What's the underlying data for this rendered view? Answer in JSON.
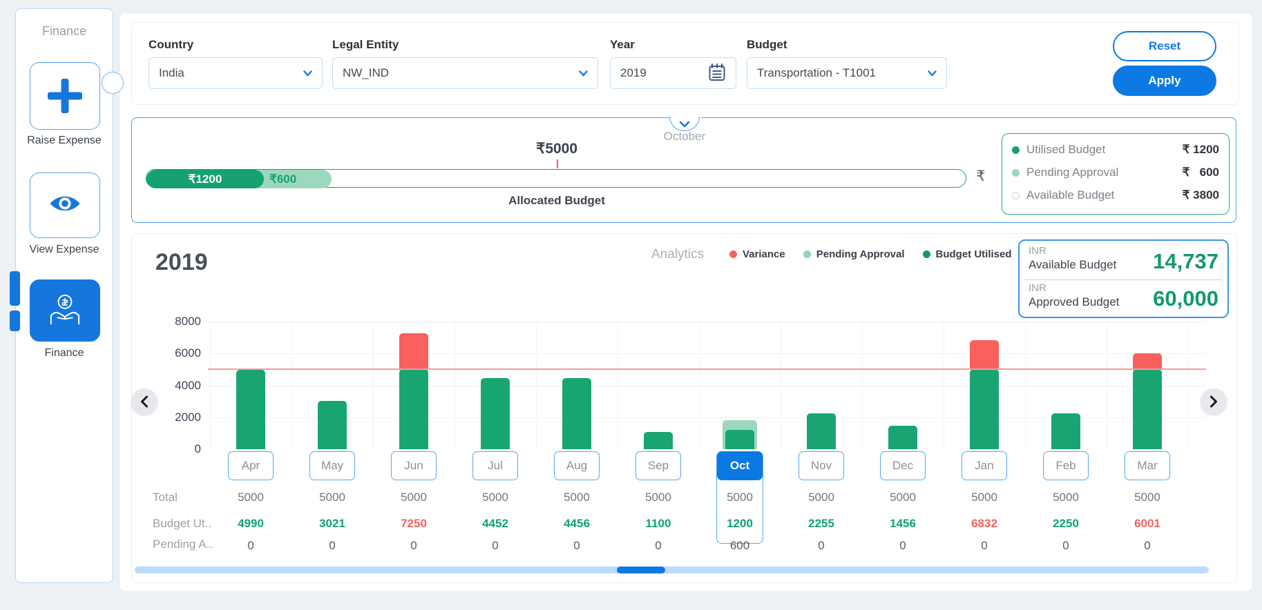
{
  "sidebar": {
    "title": "Finance",
    "items": [
      {
        "label": "Raise Expense",
        "icon": "plus-icon",
        "active": false
      },
      {
        "label": "View Expense",
        "icon": "eye-icon",
        "active": false
      },
      {
        "label": "Finance",
        "icon": "hands-coin-icon",
        "active": true
      }
    ]
  },
  "filters": {
    "fields": [
      {
        "label": "Country",
        "value": "India",
        "control": "select"
      },
      {
        "label": "Legal Entity",
        "value": "NW_IND",
        "control": "select"
      },
      {
        "label": "Year",
        "value": "2019",
        "control": "date",
        "icon": "calendar-icon"
      },
      {
        "label": "Budget",
        "value": "Transportation - T1001",
        "control": "select"
      }
    ],
    "reset_label": "Reset",
    "apply_label": "Apply"
  },
  "budget_bar": {
    "month": "October",
    "marker_label": "₹5000",
    "segments": [
      {
        "name": "utilised",
        "label": "₹1200"
      },
      {
        "name": "pending",
        "label": "₹600"
      }
    ],
    "bar_suffix": "₹",
    "axis_label": "Allocated Budget",
    "legend": [
      {
        "label": "Utilised Budget",
        "value": "₹ 1200",
        "color": "#16a173"
      },
      {
        "label": "Pending Approval",
        "value": "₹   600",
        "color": "#9bd8bd"
      },
      {
        "label": "Available Budget",
        "value": "₹ 3800",
        "color": "#ffffff"
      }
    ]
  },
  "analytics": {
    "section_label": "Analytics",
    "legend": [
      {
        "label": "Variance",
        "color": "#f5615c"
      },
      {
        "label": "Pending Approval",
        "color": "#8fd4b4"
      },
      {
        "label": "Budget Utilised",
        "color": "#12996b"
      }
    ],
    "summary": [
      {
        "currency": "INR",
        "label": "Available Budget",
        "value": "14,737"
      },
      {
        "currency": "INR",
        "label": "Approved Budget",
        "value": "60,000"
      }
    ]
  },
  "chart_data": {
    "type": "bar",
    "title": "2019",
    "categories": [
      "Apr",
      "May",
      "Jun",
      "Jul",
      "Aug",
      "Sep",
      "Oct",
      "Nov",
      "Dec",
      "Jan",
      "Feb",
      "Mar"
    ],
    "series": [
      {
        "name": "Total",
        "values": [
          5000,
          5000,
          5000,
          5000,
          5000,
          5000,
          5000,
          5000,
          5000,
          5000,
          5000,
          5000
        ]
      },
      {
        "name": "Budget Utilised",
        "values": [
          4990,
          3021,
          7250,
          4452,
          4456,
          1100,
          1200,
          2255,
          1456,
          6832,
          2250,
          6001
        ]
      },
      {
        "name": "Pending Approval",
        "values": [
          0,
          0,
          0,
          0,
          0,
          0,
          600,
          0,
          0,
          0,
          0,
          0
        ]
      }
    ],
    "threshold": 5000,
    "ylim": [
      0,
      8000
    ],
    "yticks": [
      0,
      2000,
      4000,
      6000,
      8000
    ],
    "selected_month": "Oct",
    "legend_position": "top-right",
    "grid": true
  },
  "table": {
    "row_labels": [
      "Total",
      "Budget Ut..",
      "Pending A.."
    ]
  },
  "colors": {
    "accent_blue": "#0d7ae4",
    "green": "#16a173",
    "light_green": "#9bd8bd",
    "red": "#f9605e",
    "threshold_line": "#f49b9b"
  }
}
